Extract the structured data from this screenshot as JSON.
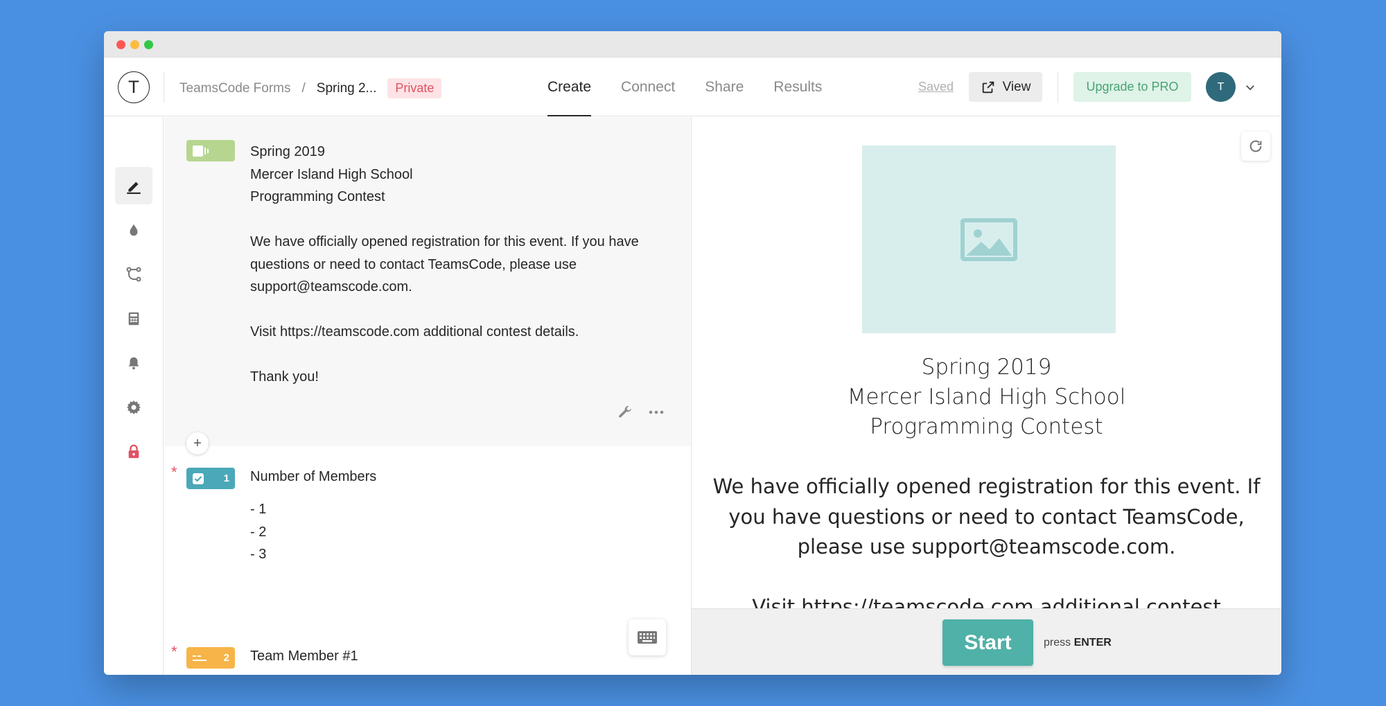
{
  "header": {
    "logo_letter": "T",
    "breadcrumb": {
      "workspace": "TeamsCode Forms",
      "separator": "/",
      "form": "Spring 2...",
      "visibility": "Private"
    },
    "tabs": [
      {
        "label": "Create",
        "active": true
      },
      {
        "label": "Connect",
        "active": false
      },
      {
        "label": "Share",
        "active": false
      },
      {
        "label": "Results",
        "active": false
      }
    ],
    "saved_label": "Saved",
    "view_label": "View",
    "upgrade_label": "Upgrade to PRO",
    "avatar_initial": "T"
  },
  "sidebar": {
    "items": [
      {
        "icon": "pencil-icon",
        "active": true
      },
      {
        "icon": "drop-icon",
        "active": false
      },
      {
        "icon": "logic-jump-icon",
        "active": false
      },
      {
        "icon": "calculator-icon",
        "active": false
      },
      {
        "icon": "bell-icon",
        "active": false
      },
      {
        "icon": "gear-icon",
        "active": false
      },
      {
        "icon": "lock-icon",
        "active": false
      }
    ]
  },
  "editor": {
    "welcome": {
      "text": "Spring 2019\nMercer Island High School\nProgramming Contest\n\nWe have officially opened registration for this event. If you have questions or need to contact TeamsCode, please use support@teamscode.com.\n\nVisit https://teamscode.com additional contest details.\n\nThank you!"
    },
    "add_label": "+",
    "questions": [
      {
        "number": "1",
        "required": "*",
        "title": "Number of Members",
        "options": [
          "- 1",
          "- 2",
          "- 3"
        ]
      },
      {
        "number": "2",
        "required": "*",
        "title": "Team Member #1"
      }
    ]
  },
  "preview": {
    "title": "Spring 2019\nMercer Island High School\nProgramming Contest",
    "body": "We have officially opened registration for this event. If\nyou have questions or need to contact TeamsCode,\nplease use support@teamscode.com.\n\nVisit https://teamscode.com additional contest",
    "start_label": "Start",
    "press_label": "press",
    "enter_label": "ENTER"
  },
  "colors": {
    "background": "#4a90e2",
    "welcome_badge": "#b6d690",
    "checkbox_badge": "#4aa8b8",
    "short_text_badge": "#f7b448",
    "start_button": "#4fb1a7",
    "private_badge": "#e05263",
    "upgrade": "#49a373"
  }
}
